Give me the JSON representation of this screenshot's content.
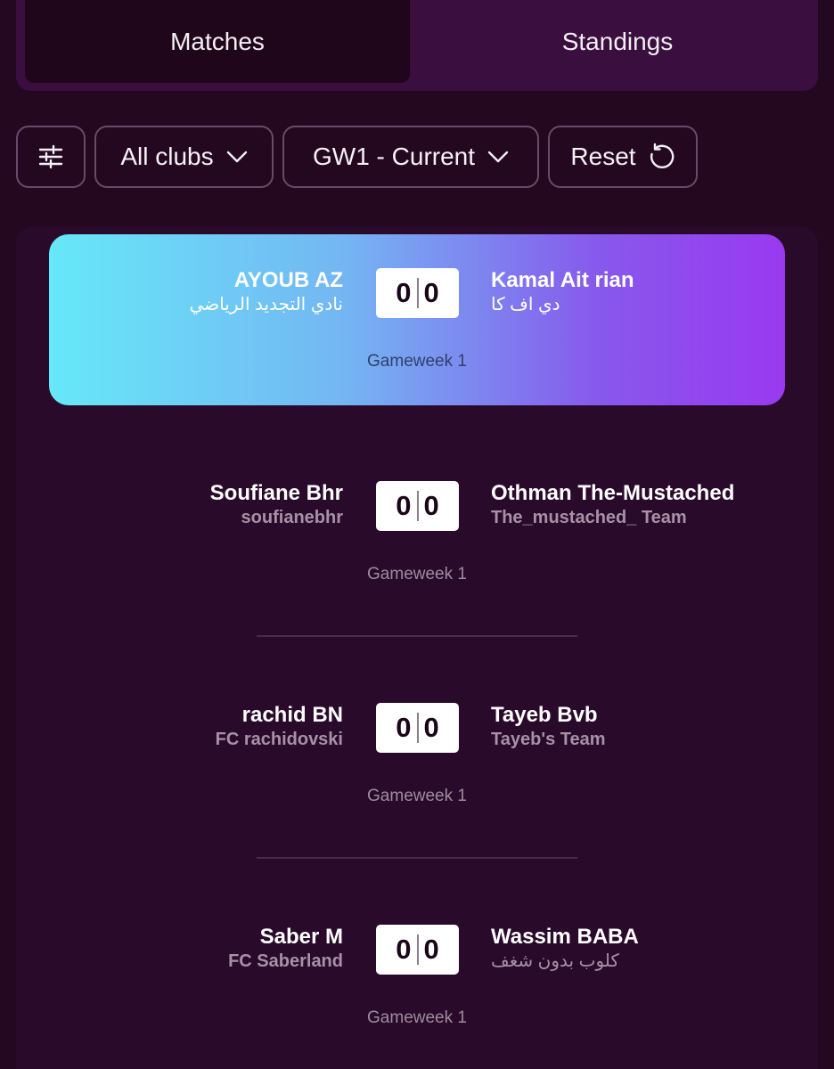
{
  "tabs": {
    "matches": "Matches",
    "standings": "Standings"
  },
  "filters": {
    "filter_icon": "sliders-icon",
    "clubs": "All clubs",
    "gameweek": "GW1 - Current",
    "reset": "Reset",
    "reset_icon": "refresh-icon"
  },
  "colors": {
    "background": "#23081f",
    "highlight_gradient_start": "#66e8f8",
    "highlight_gradient_end": "#9a39f1",
    "score_bg": "#ffffff"
  },
  "matches": [
    {
      "home_manager": "AYOUB AZ",
      "home_team": "نادي التجديد الرياضي",
      "home_score": "0",
      "away_score": "0",
      "away_manager": "Kamal Ait rian",
      "away_team": "دي اف كا",
      "gameweek": "Gameweek 1"
    },
    {
      "home_manager": "Soufiane Bhr",
      "home_team": "soufianebhr",
      "home_score": "0",
      "away_score": "0",
      "away_manager": "Othman The-Mustached",
      "away_team": "The_mustached_ Team",
      "gameweek": "Gameweek 1"
    },
    {
      "home_manager": "rachid BN",
      "home_team": "FC rachidovski",
      "home_score": "0",
      "away_score": "0",
      "away_manager": "Tayeb Bvb",
      "away_team": "Tayeb's Team",
      "gameweek": "Gameweek 1"
    },
    {
      "home_manager": "Saber M",
      "home_team": "FC Saberland",
      "home_score": "0",
      "away_score": "0",
      "away_manager": "Wassim BABA",
      "away_team": "كلوب بدون شغف",
      "gameweek": "Gameweek 1"
    }
  ]
}
